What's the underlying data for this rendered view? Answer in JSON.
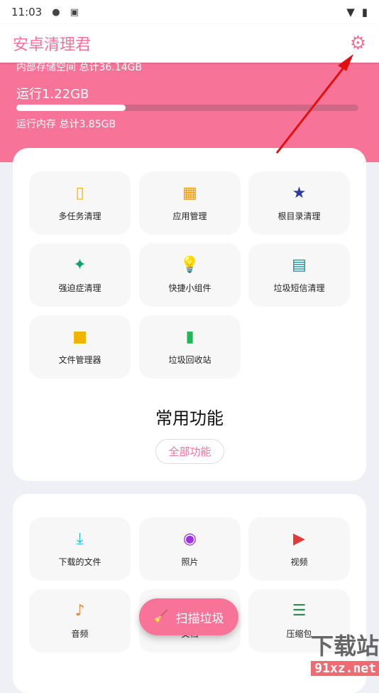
{
  "status": {
    "time": "11:03"
  },
  "app": {
    "title": "安卓清理君",
    "accent": "#f77398"
  },
  "hero": {
    "storage": "内部存储空间 总计36.14GB",
    "running": "运行1.22GB",
    "memory_progress": 0.32,
    "memory_total": "运行内存 总计3.85GB"
  },
  "tools": [
    {
      "label": "多任务清理",
      "icon": "phone-icon",
      "color": "#f5b400"
    },
    {
      "label": "应用管理",
      "icon": "apps-grid-icon",
      "color": "#f59a00"
    },
    {
      "label": "根目录清理",
      "icon": "folder-star-icon",
      "color": "#2e3a9a"
    },
    {
      "label": "强迫症清理",
      "icon": "sparkle-icon",
      "color": "#12a06a"
    },
    {
      "label": "快捷小组件",
      "icon": "lightbulb-icon",
      "color": "#0b6b5e"
    },
    {
      "label": "垃圾短信清理",
      "icon": "message-icon",
      "color": "#0d8fa0"
    },
    {
      "label": "文件管理器",
      "icon": "folder-icon",
      "color": "#f0b400"
    },
    {
      "label": "垃圾回收站",
      "icon": "trash-icon",
      "color": "#1db955"
    }
  ],
  "section": {
    "title": "常用功能",
    "all_button": "全部功能"
  },
  "files": [
    {
      "label": "下载的文件",
      "icon": "download-icon",
      "color": "#29b6d8"
    },
    {
      "label": "照片",
      "icon": "camera-icon",
      "color": "#a030e0"
    },
    {
      "label": "视频",
      "icon": "video-icon",
      "color": "#e03a3a"
    },
    {
      "label": "音频",
      "icon": "music-icon",
      "color": "#e08a40"
    },
    {
      "label": "文档",
      "icon": "document-icon",
      "color": "#3a7ae0"
    },
    {
      "label": "压缩包",
      "icon": "archive-icon",
      "color": "#2e8a50"
    }
  ],
  "fab": {
    "label": "扫描垃圾"
  },
  "watermark": {
    "text1": "下载站",
    "text2": "91xz.net"
  }
}
